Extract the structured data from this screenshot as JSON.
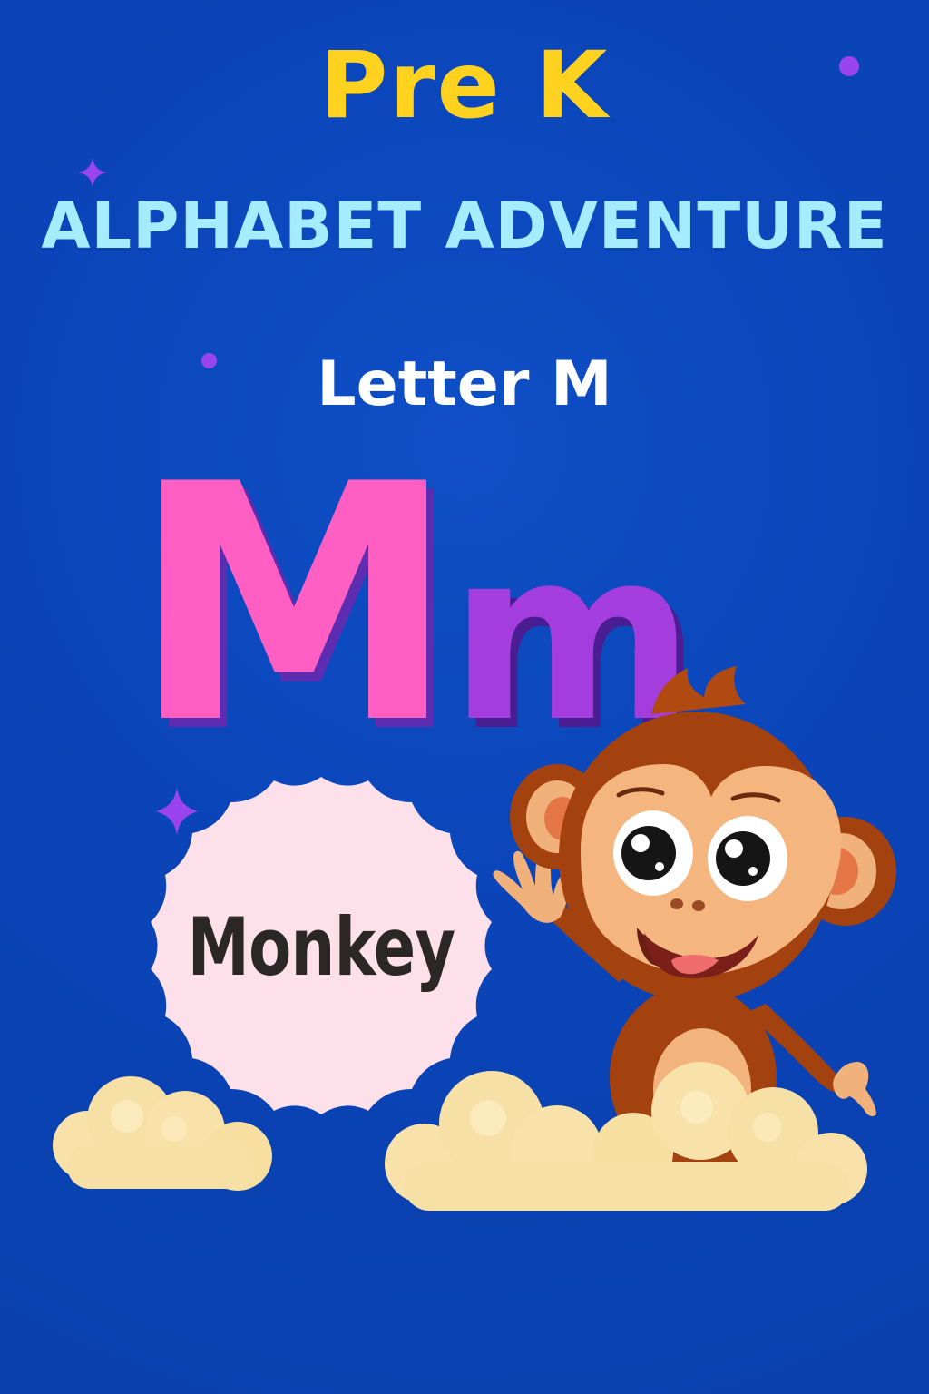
{
  "poster": {
    "top_line": "Pre K",
    "headline": "ALPHABET ADVENTURE",
    "letter_label": "Letter M",
    "uppercase_letter": "M",
    "lowercase_letter": "m",
    "word": "Monkey"
  },
  "colors": {
    "background": "#0a44b8",
    "top_line": "#ffd21f",
    "headline": "#a6ecff",
    "letter_label": "#ffffff",
    "uppercase_letter": "#ff5fc2",
    "lowercase_letter": "#a33ddd",
    "badge": "#fde0ea",
    "word": "#2b2727",
    "cloud": "#f8e2aa",
    "sparkle": "#9a44ef",
    "monkey_fur": "#a4420f",
    "monkey_face": "#f4b57f"
  },
  "icons": {
    "sparkles": [
      "sparkle-icon",
      "sparkle-icon"
    ],
    "dots": [
      "dot-icon",
      "dot-icon"
    ],
    "character": "monkey-icon",
    "clouds": [
      "cloud-icon",
      "cloud-icon"
    ],
    "badge_shape": "scalloped-badge-icon"
  }
}
